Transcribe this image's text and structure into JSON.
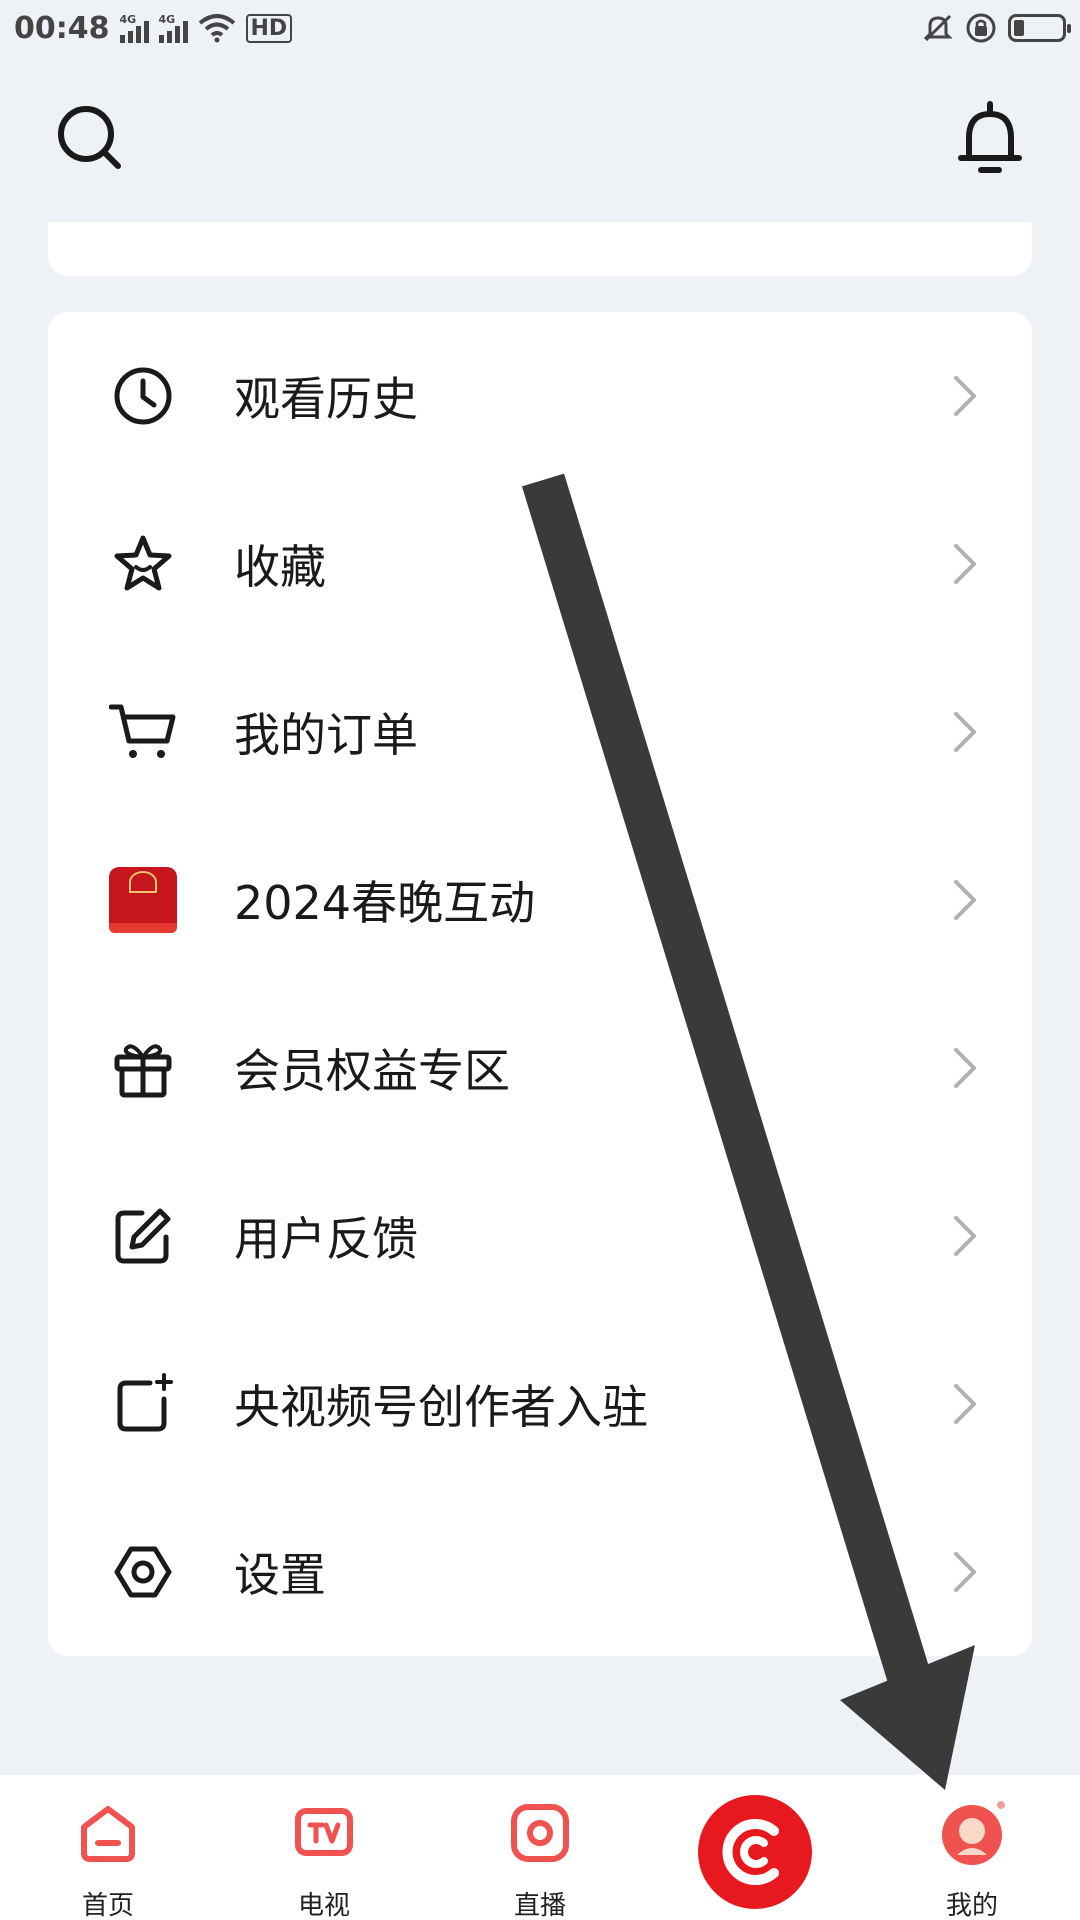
{
  "status_bar": {
    "time": "00:48",
    "signal1_tag": "4G",
    "signal2_tag": "4G",
    "hd_label": "HD",
    "icons": [
      "signal-icon",
      "signal-icon",
      "wifi-icon",
      "hd-icon",
      "mute-icon",
      "rotation-lock-icon",
      "battery-icon"
    ]
  },
  "header": {
    "icons": [
      "search-icon",
      "bell-icon"
    ]
  },
  "menu": {
    "items": [
      {
        "label": "观看历史",
        "icon": "clock-icon"
      },
      {
        "label": "收藏",
        "icon": "star-icon"
      },
      {
        "label": "我的订单",
        "icon": "cart-icon"
      },
      {
        "label": "2024春晚互动",
        "icon": "wuliangye-logo-icon"
      },
      {
        "label": "会员权益专区",
        "icon": "gift-icon"
      },
      {
        "label": "用户反馈",
        "icon": "edit-icon"
      },
      {
        "label": "央视频号创作者入驻",
        "icon": "add-creator-icon"
      },
      {
        "label": "设置",
        "icon": "settings-icon"
      }
    ]
  },
  "bottom_nav": {
    "items": [
      {
        "label": "首页",
        "icon": "home-icon"
      },
      {
        "label": "电视",
        "icon": "tv-icon"
      },
      {
        "label": "直播",
        "icon": "live-icon"
      },
      {
        "label": "",
        "icon": "cctv-center-icon"
      },
      {
        "label": "我的",
        "icon": "profile-avatar-icon"
      }
    ]
  },
  "colors": {
    "accent": "#e8181f",
    "nav_icon": "#f0524f",
    "background": "#eef1f6"
  }
}
